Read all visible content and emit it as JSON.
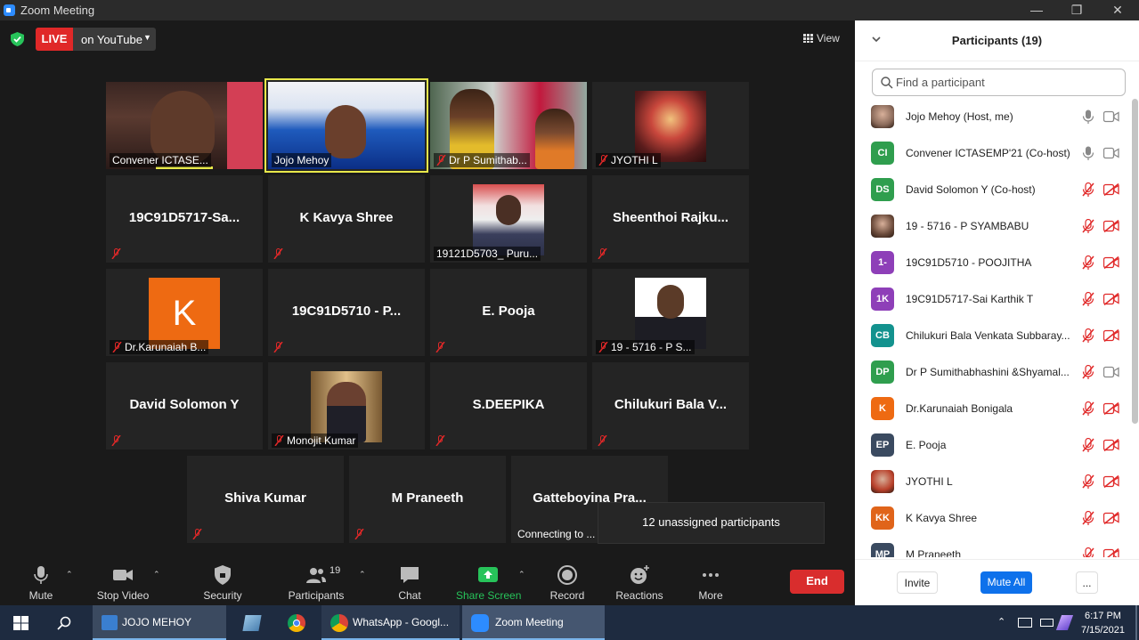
{
  "window": {
    "title": "Zoom Meeting",
    "controls": [
      "minimize-icon",
      "restore-icon",
      "close-icon"
    ]
  },
  "topbar": {
    "live_tag": "LIVE",
    "live_target": "on YouTube",
    "view_label": "View"
  },
  "tiles": [
    {
      "id": "convener",
      "label": "Convener ICTASE...",
      "type": "video"
    },
    {
      "id": "host",
      "label": "Jojo Mehoy",
      "type": "video",
      "active": true
    },
    {
      "id": "suma",
      "label": "Dr P Sumithab...",
      "type": "video",
      "muted": true
    },
    {
      "id": "jyothi",
      "label": "JYOTHI L",
      "type": "image",
      "muted": true
    },
    {
      "id": "sai",
      "name": "19C91D5717-Sa...",
      "muted": true
    },
    {
      "id": "kavya",
      "name": "K Kavya Shree",
      "muted": true
    },
    {
      "id": "puru",
      "label": "19121D5703_ Puru...",
      "type": "image"
    },
    {
      "id": "sheenthoi",
      "name": "Sheenthoi  Rajku...",
      "muted": true
    },
    {
      "id": "karunaiah",
      "label": "Dr.Karunaiah B...",
      "type": "image",
      "muted": true
    },
    {
      "id": "poojitha",
      "name": "19C91D5710 - P...",
      "muted": true
    },
    {
      "id": "pooja",
      "name": "E. Pooja",
      "muted": true
    },
    {
      "id": "syam",
      "label": "19 - 5716 - P S...",
      "type": "image",
      "muted": true
    },
    {
      "id": "david",
      "name": "David Solomon Y",
      "muted": true
    },
    {
      "id": "monojit",
      "label": "Monojit Kumar",
      "type": "image",
      "muted": true
    },
    {
      "id": "deepika",
      "name": "S.DEEPIKA",
      "muted": true
    },
    {
      "id": "chilukuri",
      "name": "Chilukuri  Bala  V...",
      "muted": true
    },
    {
      "id": "shiva",
      "name": "Shiva Kumar",
      "muted": true
    },
    {
      "id": "praneeth",
      "name": "M Praneeth",
      "muted": true
    },
    {
      "id": "gatteboyina",
      "name": "Gatteboyina  Pra...",
      "label": "Connecting to ..."
    }
  ],
  "k_avatar_letter": "K",
  "unassigned_banner": "12 unassigned participants",
  "toolbar": {
    "mute": "Mute",
    "stop_video": "Stop Video",
    "security": "Security",
    "participants": "Participants",
    "participants_count": "19",
    "chat": "Chat",
    "share_screen": "Share Screen",
    "record": "Record",
    "reactions": "Reactions",
    "more": "More",
    "end": "End"
  },
  "panel": {
    "title": "Participants (19)",
    "search_placeholder": "Find a participant",
    "participants": [
      {
        "initials": "",
        "color": "#8a6a5a",
        "photo": true,
        "name": "Jojo Mehoy (Host, me)",
        "mic": "on",
        "cam": "on"
      },
      {
        "initials": "CI",
        "color": "#2f9e4e",
        "name": "Convener ICTASEMP'21 (Co-host)",
        "mic": "on",
        "cam": "on"
      },
      {
        "initials": "DS",
        "color": "#2f9e4e",
        "name": "David Solomon Y (Co-host)",
        "mic": "off",
        "cam": "off"
      },
      {
        "initials": "",
        "color": "#6a4a3a",
        "photo": true,
        "name": "19 - 5716 - P SYAMBABU",
        "mic": "off",
        "cam": "off"
      },
      {
        "initials": "1-",
        "color": "#8e3fb8",
        "name": "19C91D5710 - POOJITHA",
        "mic": "off",
        "cam": "off"
      },
      {
        "initials": "1K",
        "color": "#8e3fb8",
        "name": "19C91D5717-Sai Karthik T",
        "mic": "off",
        "cam": "off"
      },
      {
        "initials": "CB",
        "color": "#13928e",
        "name": "Chilukuri Bala Venkata Subbaray...",
        "mic": "off",
        "cam": "off"
      },
      {
        "initials": "DP",
        "color": "#2f9e4e",
        "name": "Dr P Sumithabhashini &Shyamal...",
        "mic": "off",
        "cam": "on"
      },
      {
        "initials": "K",
        "color": "#ee6a12",
        "name": "Dr.Karunaiah Bonigala",
        "mic": "off",
        "cam": "off"
      },
      {
        "initials": "EP",
        "color": "#3a4a60",
        "name": "E. Pooja",
        "mic": "off",
        "cam": "off"
      },
      {
        "initials": "",
        "color": "#b8402a",
        "photo": true,
        "name": "JYOTHI L",
        "mic": "off",
        "cam": "off"
      },
      {
        "initials": "KK",
        "color": "#e0641a",
        "name": "K Kavya Shree",
        "mic": "off",
        "cam": "off"
      },
      {
        "initials": "MP",
        "color": "#3a4a60",
        "name": "M Praneeth",
        "mic": "off",
        "cam": "off"
      }
    ],
    "invite": "Invite",
    "mute_all": "Mute All",
    "more": "..."
  },
  "taskbar": {
    "items": [
      {
        "id": "jojo",
        "label": "JOJO MEHOY"
      },
      {
        "id": "whatsapp",
        "label": "WhatsApp - Googl..."
      },
      {
        "id": "zoom",
        "label": "Zoom Meeting"
      }
    ],
    "time": "6:17 PM",
    "date": "7/15/2021"
  },
  "colors": {
    "accent": "#2d8cff",
    "live": "#e02828",
    "end": "#d92d2d",
    "share": "#27c35a",
    "muted": "#e02828"
  }
}
